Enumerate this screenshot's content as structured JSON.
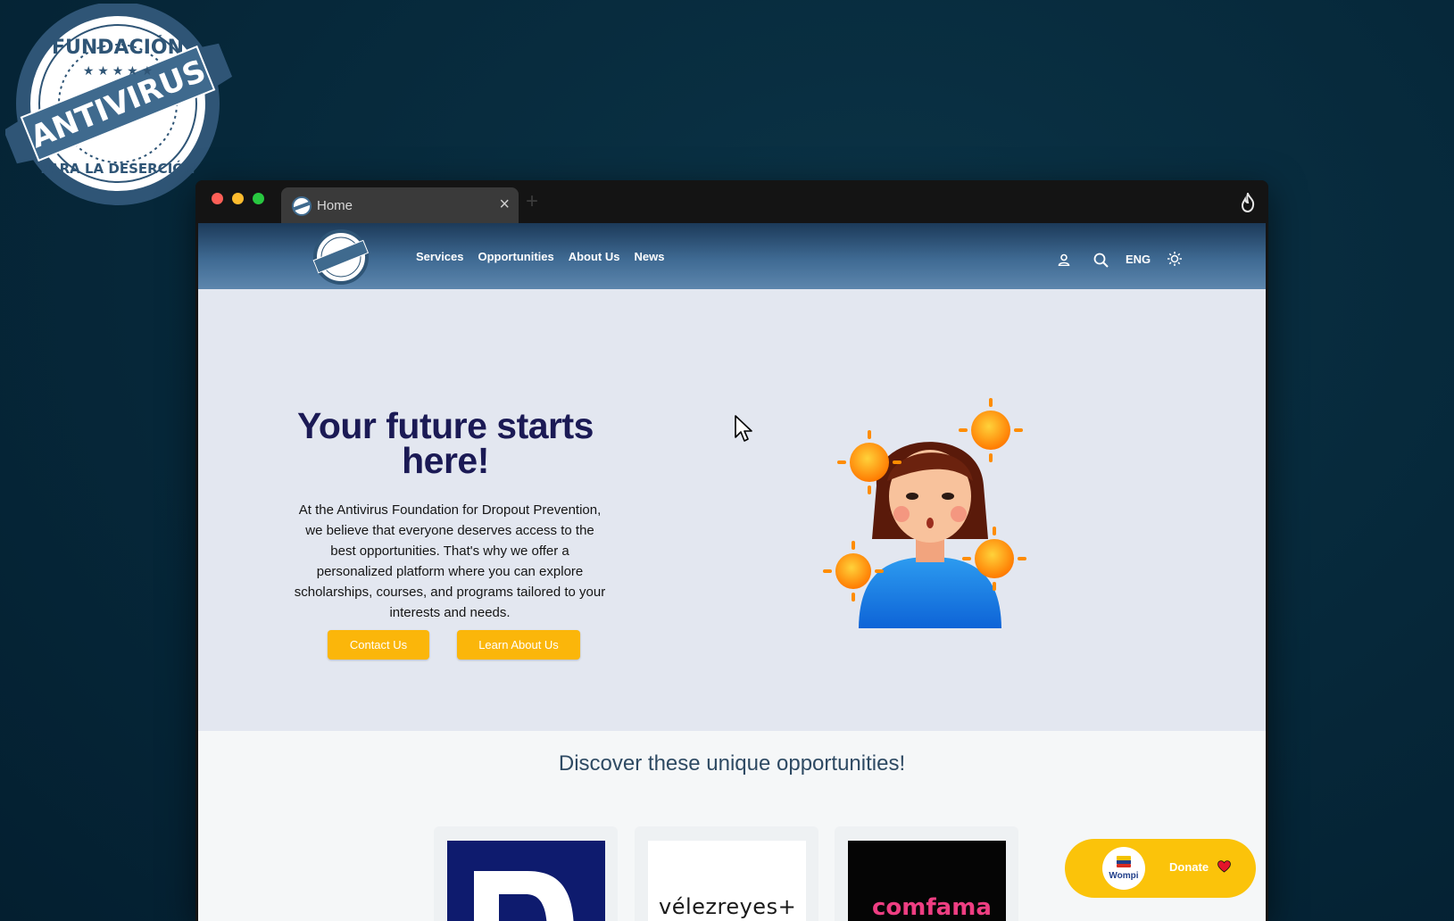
{
  "stamp": {
    "top_text": "FUNDACIÓN",
    "banner_text": "ANTIVIRUS",
    "bottom_text": "PARA LA DESERCIÓN"
  },
  "browser": {
    "tab_title": "Home",
    "close_glyph": "×",
    "new_tab_glyph": "+"
  },
  "navbar": {
    "links": [
      "Services",
      "Opportunities",
      "About Us",
      "News"
    ],
    "language": "ENG"
  },
  "hero": {
    "title": "Your future starts here!",
    "description": "At the Antivirus Foundation for Dropout Prevention, we believe that everyone deserves access to the best opportunities. That's why we offer a personalized platform where you can explore scholarships, courses, and programs tailored to your interests and needs.",
    "contact_button": "Contact Us",
    "learn_button": "Learn About Us"
  },
  "opportunities": {
    "title": "Discover these unique opportunities!",
    "cards": [
      {
        "logo_text": "D"
      },
      {
        "logo_text": "vélezreyes+"
      },
      {
        "logo_text": "comfama"
      }
    ]
  },
  "donate": {
    "wompi_label": "Wompi",
    "label": "Donate"
  },
  "colors": {
    "brand_navy": "#1b1a55",
    "accent_yellow": "#fbb60a",
    "nav_blue": "#3f6a93"
  },
  "icons": [
    "user-icon",
    "search-icon",
    "sun-icon",
    "heart-icon",
    "flame-icon",
    "close-icon",
    "cursor-icon"
  ]
}
